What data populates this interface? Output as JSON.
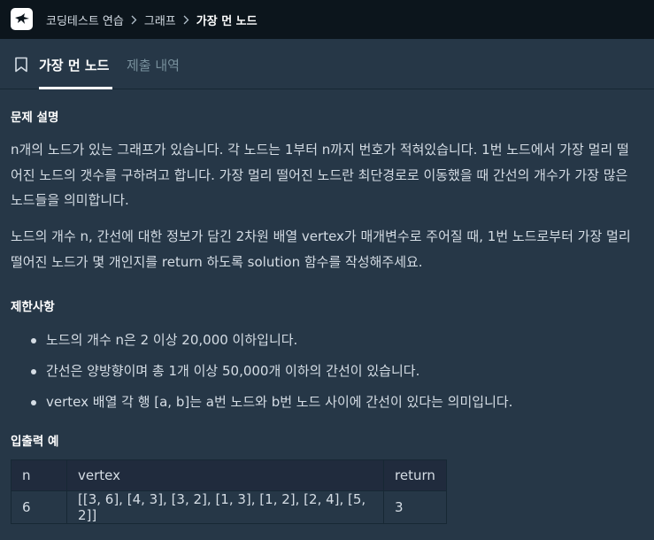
{
  "breadcrumb": {
    "items": [
      "코딩테스트 연습",
      "그래프"
    ],
    "current": "가장 먼 노드"
  },
  "tabs": {
    "active": "가장 먼 노드",
    "inactive": "제출 내역"
  },
  "problem": {
    "description_heading": "문제 설명",
    "paragraphs": [
      "n개의 노드가 있는 그래프가 있습니다. 각 노드는 1부터 n까지 번호가 적혀있습니다. 1번 노드에서 가장 멀리 떨어진 노드의 갯수를 구하려고 합니다. 가장 멀리 떨어진 노드란 최단경로로 이동했을 때 간선의 개수가 가장 많은 노드들을 의미합니다.",
      "노드의 개수 n, 간선에 대한 정보가 담긴 2차원 배열 vertex가 매개변수로 주어질 때, 1번 노드로부터 가장 멀리 떨어진 노드가 몇 개인지를 return 하도록 solution 함수를 작성해주세요."
    ],
    "limits_heading": "제한사항",
    "limits": [
      "노드의 개수 n은 2 이상 20,000 이하입니다.",
      "간선은 양방향이며 총 1개 이상 50,000개 이하의 간선이 있습니다.",
      "vertex 배열 각 행 [a, b]는 a번 노드와 b번 노드 사이에 간선이 있다는 의미입니다."
    ],
    "example_heading": "입출력 예",
    "example_table": {
      "headers": [
        "n",
        "vertex",
        "return"
      ],
      "rows": [
        [
          "6",
          "[[3, 6], [4, 3], [3, 2], [1, 3], [1, 2], [2, 4], [5, 2]]",
          "3"
        ]
      ]
    }
  },
  "icons": {
    "logo": "programmers-logo-icon",
    "separator": "chevron-right-icon",
    "tab": "bookmark-icon"
  },
  "colors": {
    "topbar": "#0c151c",
    "background": "#263747",
    "table_header": "#202b3d",
    "accent": "#ffffff"
  }
}
